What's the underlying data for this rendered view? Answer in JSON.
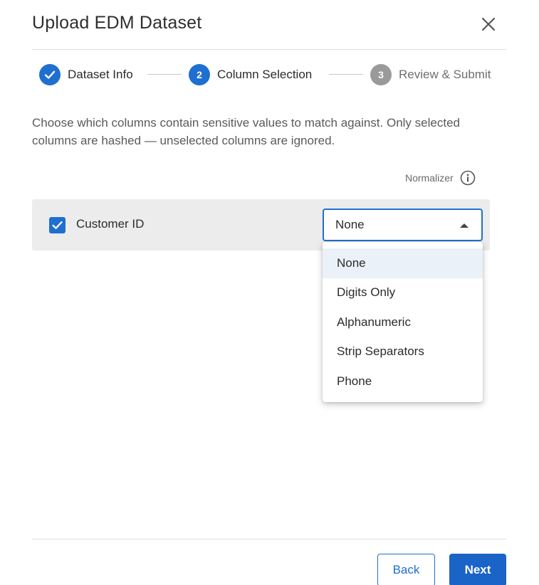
{
  "dialog": {
    "title": "Upload EDM Dataset"
  },
  "stepper": {
    "steps": [
      {
        "number": "1",
        "label": "Dataset Info",
        "status": "complete"
      },
      {
        "number": "2",
        "label": "Column Selection",
        "status": "active"
      },
      {
        "number": "3",
        "label": "Review & Submit",
        "status": "pending"
      }
    ]
  },
  "description": "Choose which columns contain sensitive values to match against. Only selected columns are hashed — unselected columns are ignored.",
  "normalizer_header": {
    "label": "Normalizer",
    "icon": "info-icon"
  },
  "column": {
    "name": "Customer ID",
    "checked": true,
    "normalizer_value": "None"
  },
  "normalizer_options": [
    "None",
    "Digits Only",
    "Alphanumeric",
    "Strip Separators",
    "Phone"
  ],
  "footer": {
    "back_label": "Back",
    "next_label": "Next"
  },
  "colors": {
    "accent": "#1f6fd1",
    "primary_button": "#1a63c7",
    "pending_step": "#9a9a9a",
    "row_background": "#ececec",
    "selected_option": "#eaf1f8"
  }
}
